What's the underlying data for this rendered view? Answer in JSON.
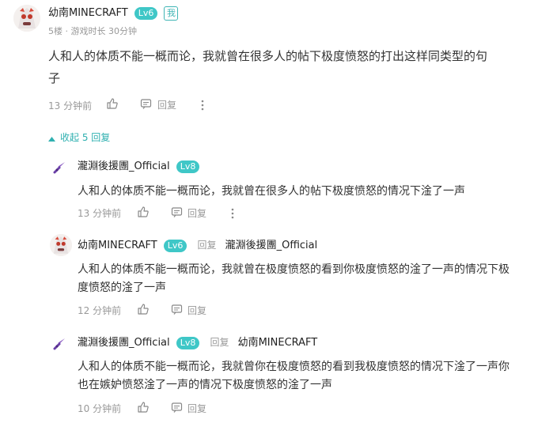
{
  "comment": {
    "username": "幼南MINECRAFT",
    "level": "Lv6",
    "self_tag": "我",
    "floor": "5楼",
    "separator": "·",
    "playtime": "游戏时长 30分钟",
    "text_line1": "人和人的体质不能一概而论，我就曾在很多人的帖下极度愤怒的打出这样同类型的句",
    "text_line2": "子",
    "time": "13 分钟前",
    "reply_label": "回复"
  },
  "collapse_label": "收起 5 回复",
  "replies": [
    {
      "username": "瀧淵後援團_Official",
      "level": "Lv8",
      "text_line1": "人和人的体质不能一概而论，我就曾在很多人的帖下极度愤怒的情况下淦了一声",
      "time": "13 分钟前",
      "reply_label": "回复"
    },
    {
      "username": "幼南MINECRAFT",
      "level": "Lv6",
      "reply_word": "回复",
      "target": "瀧淵後援團_Official",
      "text_line1": "人和人的体质不能一概而论，我就曾在极度愤怒的看到你极度愤怒的淦了一声的情况下极",
      "text_line2": "度愤怒的淦了一声",
      "time": "12 分钟前",
      "reply_label": "回复"
    },
    {
      "username": "瀧淵後援團_Official",
      "level": "Lv8",
      "reply_word": "回复",
      "target": "幼南MINECRAFT",
      "text_line1": "人和人的体质不能一概而论，我就曾你在极度愤怒的看到我极度愤怒的情况下淦了一声你",
      "text_line2": "也在嫉妒愤怒淦了一声的情况下极度愤怒的淦了一声",
      "time": "10 分钟前",
      "reply_label": "回复"
    }
  ],
  "colors": {
    "accent": "#2fb0b0",
    "level_badge": "#3fc7c7"
  },
  "icons": [
    "avatar-knight",
    "sword-icon",
    "thumb-up-icon",
    "comment-icon",
    "more-vert-icon",
    "caret-up-icon"
  ]
}
